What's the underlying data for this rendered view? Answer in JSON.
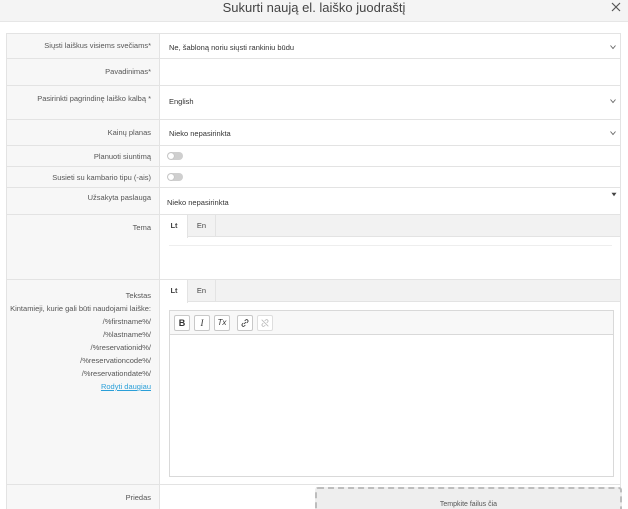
{
  "dialog": {
    "title": "Sukurti naują el. laiško juodraštį"
  },
  "fields": {
    "send_to_all": {
      "label": "Siųsti laiškus visiems svečiams*",
      "value": "Ne, šabloną noriu siųsti rankiniu būdu"
    },
    "name": {
      "label": "Pavadinimas*",
      "value": ""
    },
    "language": {
      "label": "Pasirinkti pagrindinę laiško kalbą *",
      "value": "English"
    },
    "price_plan": {
      "label": "Kainų planas",
      "value": "Nieko nepasirinkta"
    },
    "schedule": {
      "label": "Planuoti siuntimą",
      "enabled": false
    },
    "room_type": {
      "label": "Susieti su kambario tipu (-ais)",
      "enabled": false
    },
    "service": {
      "label": "Užsakyta paslauga",
      "value": "Nieko nepasirinkta"
    },
    "subject": {
      "label": "Tema",
      "tabs": [
        "Lt",
        "En"
      ],
      "active_tab": "Lt"
    },
    "body": {
      "label": "Tekstas",
      "tabs": [
        "Lt",
        "En"
      ],
      "active_tab": "Lt",
      "vars_title": "Kintamieji, kurie gali būti naudojami laiške:",
      "variables": [
        "/%firstname%/",
        "/%lastname%/",
        "/%reservationid%/",
        "/%reservationcode%/",
        "/%reservationdate%/"
      ],
      "show_more": "Rodyti daugiau",
      "toolbar": {
        "bold": "B",
        "italic": "I",
        "clear": "Tx"
      }
    },
    "attachments": {
      "label": "Priedas",
      "drop_text": "Tempkite failus čia"
    }
  },
  "colors": {
    "link": "#2a9fd8",
    "label_bg": "#f7f7f7",
    "border": "#e3e3e3"
  }
}
